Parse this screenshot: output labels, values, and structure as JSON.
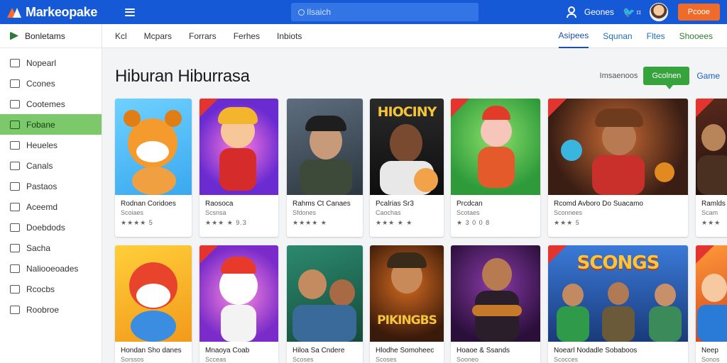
{
  "topbar": {
    "logo": "Markeopake",
    "search_placeholder": "Ilsaich",
    "user_label": "Geones",
    "small_label": "ɪɪ",
    "orange_button": "Pcooe",
    "brand_color": "#1659d6",
    "accent_color": "#f06a2a"
  },
  "sidebar": {
    "header": "Bonletams",
    "items": [
      {
        "label": "Nopearl",
        "icon": "warning-icon"
      },
      {
        "label": "Ccones",
        "icon": "list-icon"
      },
      {
        "label": "Cootemes",
        "icon": "grid-icon"
      },
      {
        "label": "Fobane",
        "icon": "folder-icon",
        "active": true
      },
      {
        "label": "Heueles",
        "icon": "doc-icon"
      },
      {
        "label": "Canals",
        "icon": "card-icon"
      },
      {
        "label": "Pastaos",
        "icon": "doc-icon"
      },
      {
        "label": "Aceemd",
        "icon": "book-icon"
      },
      {
        "label": "Doebdods",
        "icon": "users-icon"
      },
      {
        "label": "Sacha",
        "icon": "chart-icon"
      },
      {
        "label": "Naliooeoades",
        "icon": "doc-icon"
      },
      {
        "label": "Rcocbs",
        "icon": "search-icon"
      },
      {
        "label": "Roobroe",
        "icon": "tag-icon"
      }
    ]
  },
  "tabs": {
    "left": [
      "Kcl",
      "Mcpars",
      "Forrars",
      "Ferhes",
      "Inbiots"
    ],
    "right": [
      {
        "label": "Asipees",
        "active": true
      },
      {
        "label": "Squnan"
      },
      {
        "label": "Fltes"
      },
      {
        "label": "Shooees",
        "green": true
      }
    ]
  },
  "section": {
    "title": "Hiburan Hiburrasa",
    "link": "Imsaenoos",
    "green_button": "Gcolnen",
    "game_link": "Game",
    "green_color": "#36a33c"
  },
  "row1": [
    {
      "title": "Rodnan Coridoes",
      "sub": "Scoiaes",
      "rating": "★★★★ 5"
    },
    {
      "title": "Raosoca",
      "sub": "Scsnsa",
      "rating": "★★★ ★ 9.3"
    },
    {
      "title": "Rahms Ct Canaes",
      "sub": "Sfdones",
      "rating": "★★★★ ★"
    },
    {
      "title": "Pcalrias Sr3",
      "sub": "Caochas",
      "rating": "★★★ ★ ★"
    },
    {
      "title": "Prcdcan",
      "sub": "Scotaes",
      "rating": "★ 3 0 0 8"
    },
    {
      "title": "Rcomd Avboro Do Suacamo",
      "sub": "Sconnees",
      "rating": "★★★ 5"
    },
    {
      "title": "Ramlds",
      "sub": "Scam",
      "rating": "★★★"
    }
  ],
  "row2": [
    {
      "title": "Hondan Sho danes",
      "sub": "Sorssos"
    },
    {
      "title": "Mnaoya Coab",
      "sub": "Scceas"
    },
    {
      "title": "Hiloa Sa Cndere",
      "sub": "Scoses"
    },
    {
      "title": "Hlodhe Somoheec",
      "sub": "Scoses"
    },
    {
      "title": "Hoaoe & Ssands",
      "sub": "Sooneo"
    },
    {
      "title": "Noearl Nodadle Sobaboos",
      "sub": "Scocces"
    },
    {
      "title": "Neep",
      "sub": "Sonos"
    }
  ],
  "art": {
    "r1_4": "HIOCINY",
    "r2_4": "PIKINGBS",
    "r2_6": "SCONGS"
  }
}
